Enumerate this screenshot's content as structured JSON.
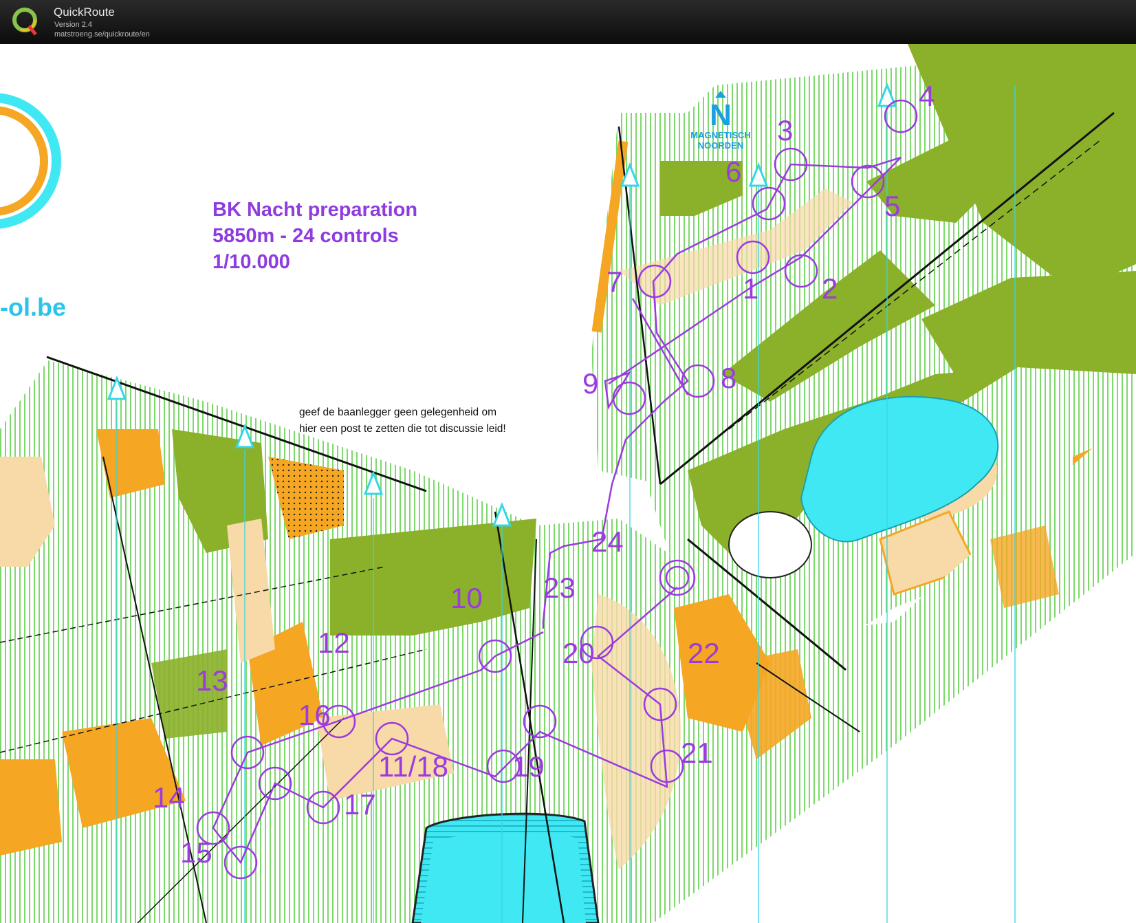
{
  "app": {
    "name": "QuickRoute",
    "version": "Version 2.4",
    "url": "matstroeng.se/quickroute/en",
    "logo_letter": "Q"
  },
  "map": {
    "title_lines": [
      "BK Nacht preparation",
      "5850m - 24 controls",
      "1/10.000"
    ],
    "site_text": "-ol.be",
    "north_label": [
      "MAGNETISCH",
      "NOORDEN"
    ],
    "north_letter": "N",
    "note_lines": [
      "geef de baanlegger geen gelegenheid om",
      "hier een post te zetten die tot discussie leid!"
    ],
    "controls": [
      {
        "label": "1"
      },
      {
        "label": "2"
      },
      {
        "label": "3"
      },
      {
        "label": "4"
      },
      {
        "label": "5"
      },
      {
        "label": "6"
      },
      {
        "label": "7"
      },
      {
        "label": "8"
      },
      {
        "label": "9"
      },
      {
        "label": "10"
      },
      {
        "label": "11/18"
      },
      {
        "label": "12"
      },
      {
        "label": "13"
      },
      {
        "label": "14"
      },
      {
        "label": "15"
      },
      {
        "label": "16"
      },
      {
        "label": "17"
      },
      {
        "label": "19"
      },
      {
        "label": "20"
      },
      {
        "label": "21"
      },
      {
        "label": "22"
      },
      {
        "label": "23"
      },
      {
        "label": "24"
      }
    ]
  },
  "colors": {
    "course": "#9b3ae0",
    "forest": "#8bb02a",
    "open": "#f5a623",
    "light_open": "#f8d9a8",
    "water": "#3fe8f2",
    "north_lines": "#35d6e6"
  }
}
